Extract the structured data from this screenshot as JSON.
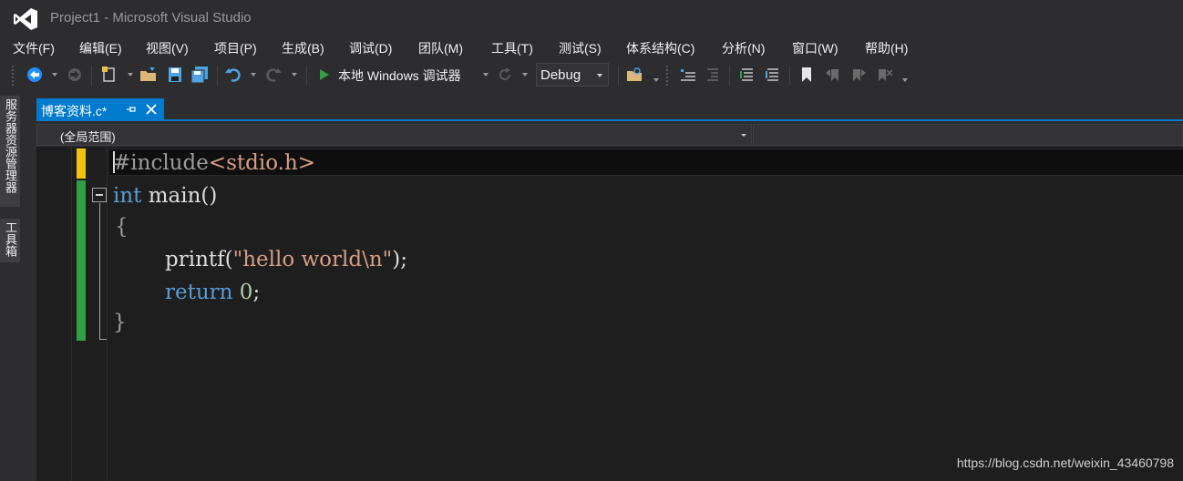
{
  "window": {
    "title": "Project1 - Microsoft Visual Studio",
    "logo_icon": "visual-studio-logo-icon"
  },
  "menu": [
    {
      "label": "文件(F)"
    },
    {
      "label": "编辑(E)"
    },
    {
      "label": "视图(V)"
    },
    {
      "label": "项目(P)"
    },
    {
      "label": "生成(B)"
    },
    {
      "label": "调试(D)"
    },
    {
      "label": "团队(M)"
    },
    {
      "label": "工具(T)"
    },
    {
      "label": "测试(S)"
    },
    {
      "label": "体系结构(C)"
    },
    {
      "label": "分析(N)"
    },
    {
      "label": "窗口(W)"
    },
    {
      "label": "帮助(H)"
    }
  ],
  "toolbar": {
    "start_debugger_label": "本地 Windows 调试器",
    "configuration": "Debug"
  },
  "sidebar": {
    "tabs": [
      {
        "label": "服务器资源管理器"
      },
      {
        "label": "工具箱"
      }
    ]
  },
  "document_tab": {
    "label": "博客资料.c*"
  },
  "navigation": {
    "scope": "(全局范围)"
  },
  "code": {
    "line1_directive": "#include",
    "line1_header": "<stdio.h>",
    "line2_kw": "int",
    "line2_rest": " main()",
    "line3": "{",
    "line4_fn": "printf(",
    "line4_str": "\"hello world\\n\"",
    "line4_end": ");",
    "line5_kw": "return",
    "line5_num": "0",
    "line5_end": ";",
    "line6": "}"
  },
  "colors": {
    "accent": "#007acc",
    "keyword": "#569cd6",
    "string": "#d69d85",
    "number": "#b5cea8",
    "change_saved": "#2ea043",
    "change_unsaved": "#f1c40f"
  },
  "watermark": "https://blog.csdn.net/weixin_43460798"
}
